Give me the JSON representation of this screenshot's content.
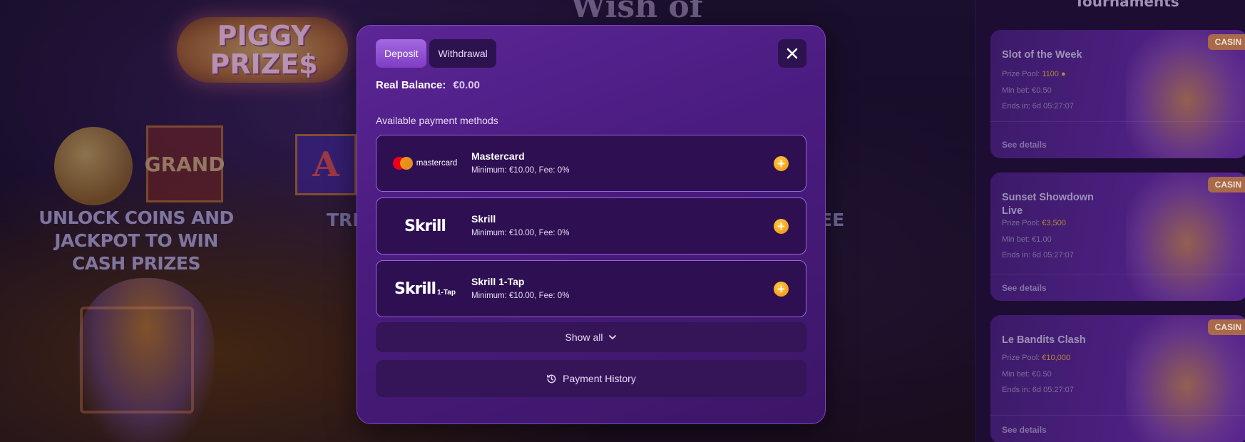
{
  "background": {
    "logo_text": "PIGGY PRIZE$",
    "grand_label": "GRAND",
    "tile_letter": "A",
    "promo_text": "UNLOCK COINS AND JACKPOT TO WIN CASH PRIZES",
    "partial_left": "TRIC",
    "partial_right": "EE",
    "top_title": "Wish of"
  },
  "sidebar": {
    "title": "Tournaments",
    "cards": [
      {
        "name": "Slot of the Week",
        "badge": "CASIN",
        "prize_label": "Prize Pool:",
        "prize_value": "1100",
        "min_bet": "Min bet: €0.50",
        "ends_in": "Ends in: 6d 05:27:07",
        "details": "See details"
      },
      {
        "name": "Sunset Showdown Live",
        "badge": "CASIN",
        "prize_label": "Prize Pool:",
        "prize_value": "€3,500",
        "min_bet": "Min bet: €1.00",
        "ends_in": "Ends in: 6d 05:27:07",
        "details": "See details"
      },
      {
        "name": "Le Bandits Clash",
        "badge": "CASIN",
        "prize_label": "Prize Pool:",
        "prize_value": "€10,000",
        "min_bet": "Min bet: €0.50",
        "ends_in": "Ends in: 6d 05:27:07",
        "details": "See details"
      }
    ]
  },
  "modal": {
    "tabs": [
      {
        "label": "Deposit",
        "active": true
      },
      {
        "label": "Withdrawal",
        "active": false
      }
    ],
    "balance_label": "Real Balance:",
    "balance_amount": "€0.00",
    "methods_heading": "Available payment methods",
    "methods": [
      {
        "name": "Mastercard",
        "logo": "mastercard",
        "logo_text": "mastercard",
        "details": "Minimum: €10.00, Fee: 0%"
      },
      {
        "name": "Skrill",
        "logo": "skrill",
        "logo_text": "Skrill",
        "details": "Minimum: €10.00, Fee: 0%"
      },
      {
        "name": "Skrill 1-Tap",
        "logo": "skrill-1tap",
        "logo_text": "Skrill",
        "logo_sub": "1-Tap",
        "details": "Minimum: €10.00, Fee: 0%"
      }
    ],
    "show_all_label": "Show all",
    "history_label": "Payment History"
  },
  "colors": {
    "modal_bg": "#4a1c80",
    "tab_active": "#8f4fd2",
    "card_border": "#9a62d8",
    "add_button": "#f5a623",
    "accent_gold": "#b38638"
  },
  "icons": {
    "close": "close-icon",
    "add": "plus-circle-icon",
    "chevron": "chevron-down-icon",
    "history": "history-icon"
  }
}
